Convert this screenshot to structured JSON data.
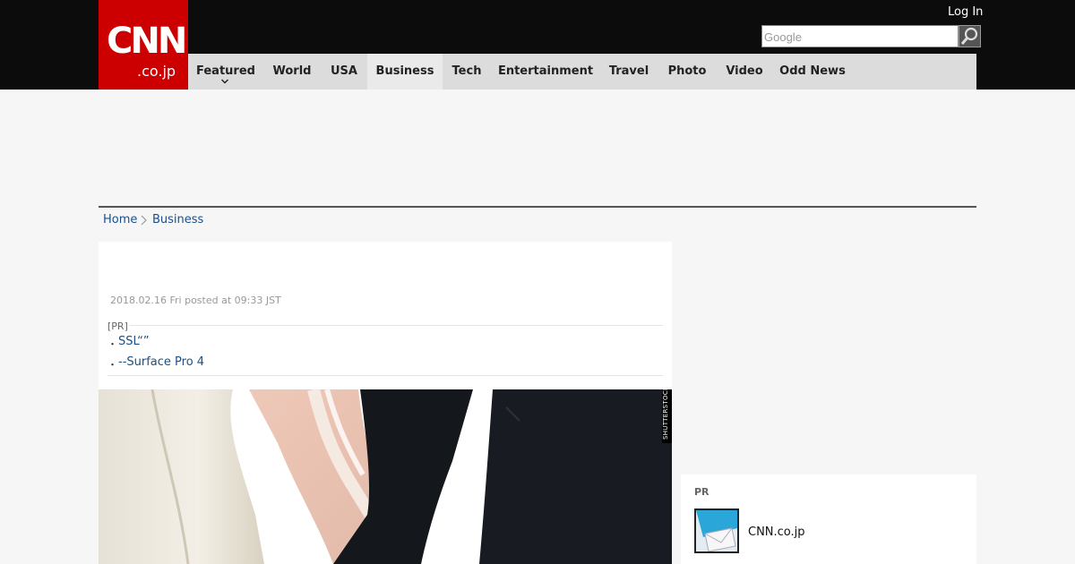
{
  "logo": {
    "main": "CNN",
    "sub": ".co.jp"
  },
  "header": {
    "login_label": "Log In",
    "search_placeholder": "Google"
  },
  "nav": {
    "items": [
      {
        "label": "Featured"
      },
      {
        "label": "World"
      },
      {
        "label": "USA"
      },
      {
        "label": "Business"
      },
      {
        "label": "Tech"
      },
      {
        "label": "Entertainment"
      },
      {
        "label": "Travel"
      },
      {
        "label": "Photo"
      },
      {
        "label": "Video"
      },
      {
        "label": "Odd News"
      }
    ],
    "active": "Business"
  },
  "breadcrumb": {
    "home": "Home",
    "current": "Business"
  },
  "article": {
    "date": "2018.02.16 Fri posted at 09:33 JST",
    "pr_label": "[PR]",
    "pr_bullet": "・",
    "pr_links": [
      "SSL“”",
      "--Surface Pro 4"
    ],
    "photo_credit": "SHUTTERSTOCK"
  },
  "sidebar": {
    "title": "PR",
    "link_label": "CNN.co.jp"
  },
  "colors": {
    "header_bg": "#0c0c0c",
    "logo_bg": "#cc0000",
    "nav_bg": "#dcdcdc",
    "link": "#1a4f8a"
  },
  "icons": [
    "search-icon",
    "chevron-down-icon",
    "chevron-right-icon"
  ]
}
